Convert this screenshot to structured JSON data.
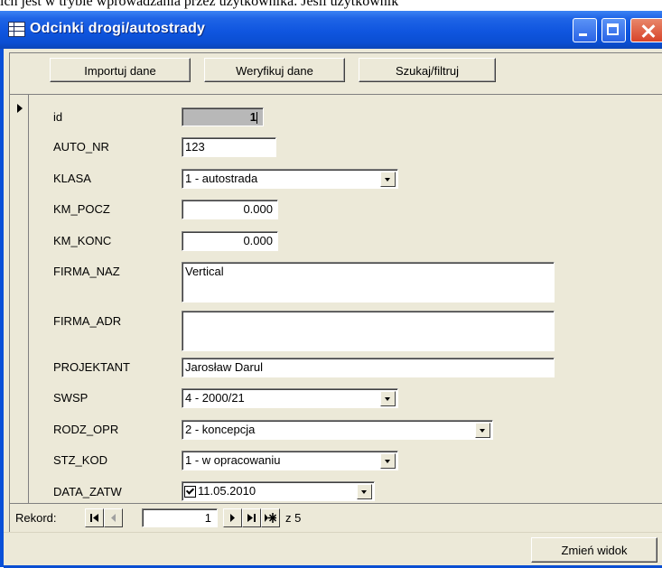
{
  "background_text": "ich jest w trybie wprowadzania przez użytkownika. Jeśli użytkownik",
  "window": {
    "title": "Odcinki drogi/autostrady"
  },
  "toolbar": {
    "import_label": "Importuj dane",
    "verify_label": "Weryfikuj dane",
    "search_label": "Szukaj/filtruj"
  },
  "fields": {
    "id": {
      "label": "id",
      "value": "1"
    },
    "auto_nr": {
      "label": "AUTO_NR",
      "value": "123"
    },
    "klasa": {
      "label": "KLASA",
      "value": "1 - autostrada"
    },
    "km_pocz": {
      "label": "KM_POCZ",
      "value": "0.000"
    },
    "km_konc": {
      "label": "KM_KONC",
      "value": "0.000"
    },
    "firma_naz": {
      "label": "FIRMA_NAZ",
      "value": "Vertical"
    },
    "firma_adr": {
      "label": "FIRMA_ADR",
      "value": ""
    },
    "projektant": {
      "label": "PROJEKTANT",
      "value": "Jarosław Darul"
    },
    "swsp": {
      "label": "SWSP",
      "value": "4 - 2000/21"
    },
    "rodz_opr": {
      "label": "RODZ_OPR",
      "value": "2 - koncepcja"
    },
    "stz_kod": {
      "label": "STZ_KOD",
      "value": "1 - w opracowaniu"
    },
    "data_zatw": {
      "label": "DATA_ZATW",
      "value": "11.05.2010",
      "checked": true
    }
  },
  "navigation": {
    "label": "Rekord:",
    "current": "1",
    "total_text": "z 5"
  },
  "footer": {
    "change_view_label": "Zmień widok"
  },
  "colors": {
    "titlebar": "#0a4ed2",
    "face": "#ece9d8",
    "close": "#d8442a"
  },
  "icons": [
    "form-icon",
    "minimize-icon",
    "maximize-icon",
    "close-icon",
    "record-selector-icon",
    "first-record-icon",
    "prev-record-icon",
    "next-record-icon",
    "last-record-icon",
    "new-record-icon",
    "dropdown-arrow-icon",
    "checkbox-icon"
  ]
}
